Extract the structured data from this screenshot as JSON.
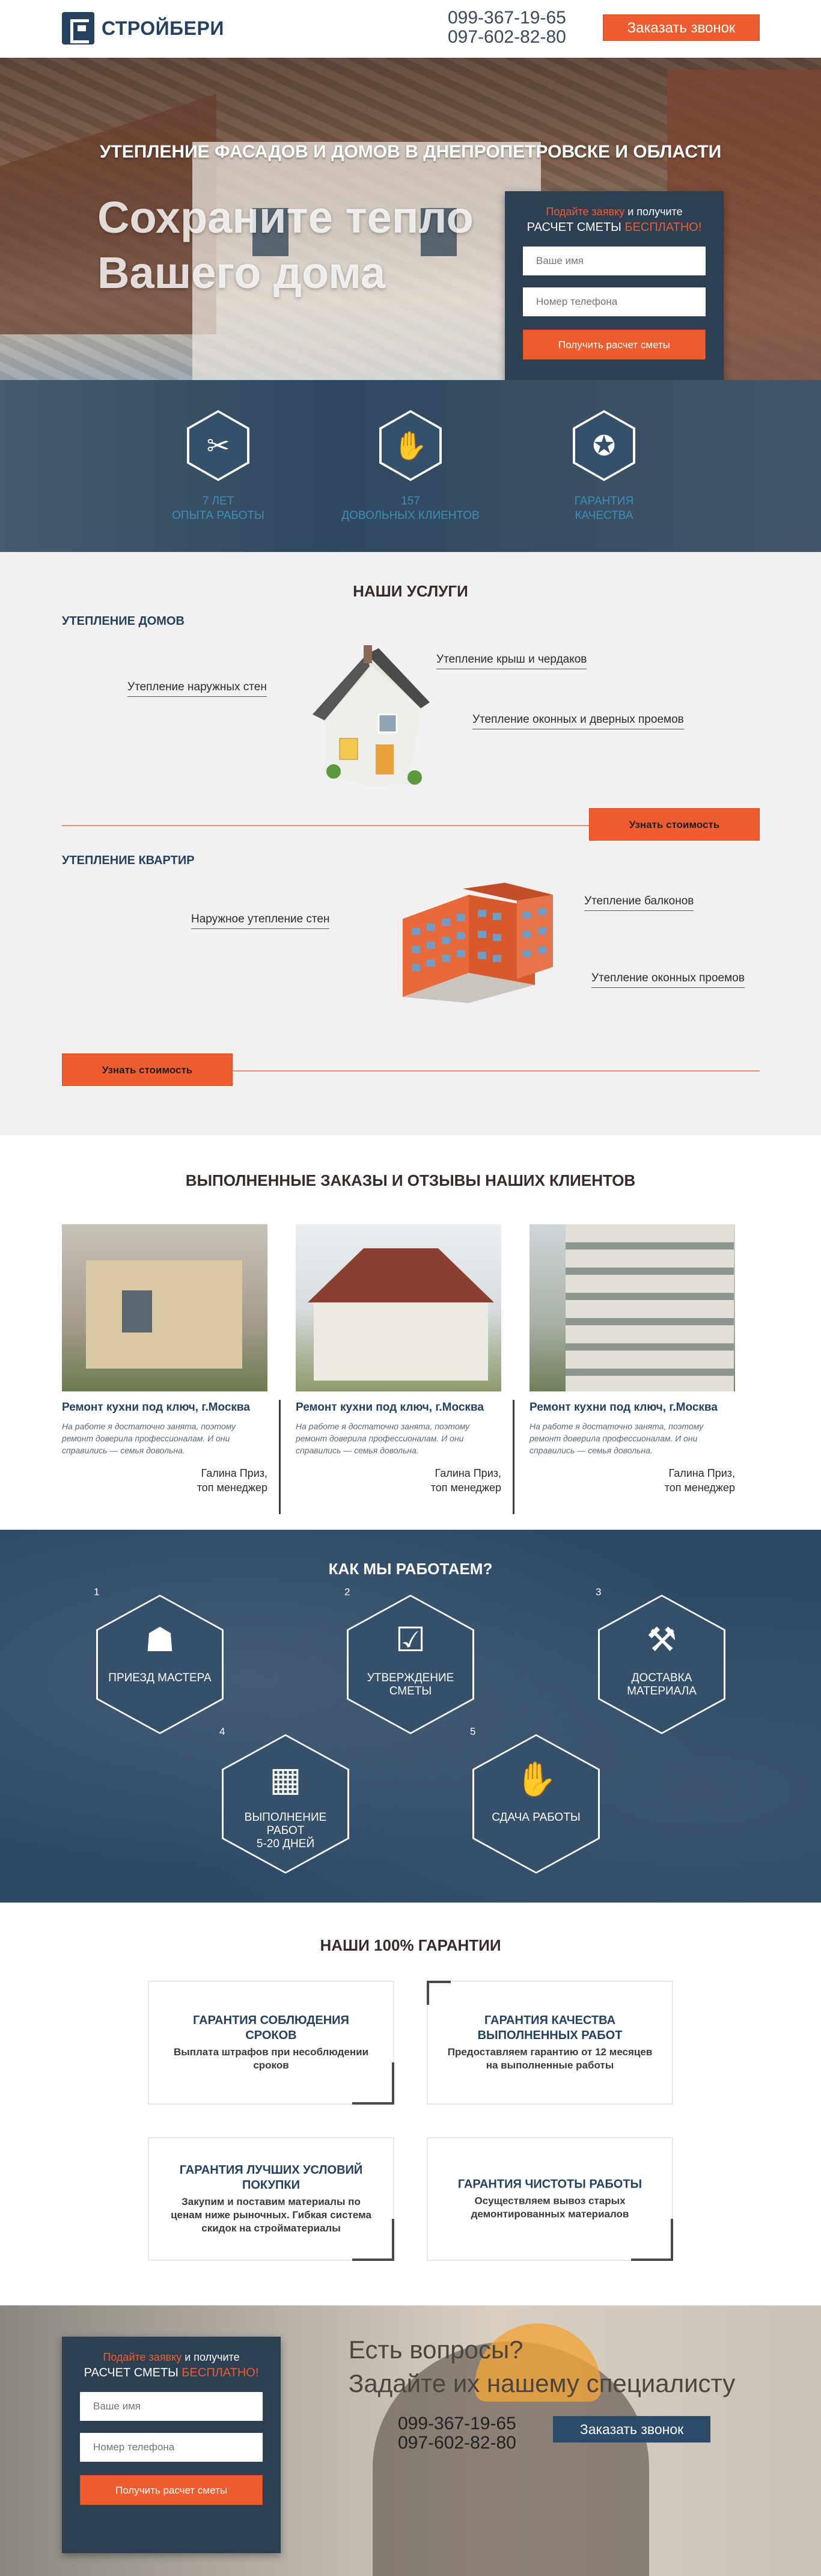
{
  "header": {
    "logo_text": "СТРОЙБЕРИ",
    "phone1": "099-367-19-65",
    "phone2": "097-602-82-80",
    "call_button": "Заказать звонок"
  },
  "hero": {
    "title": "УТЕПЛЕНИЕ ФАСАДОВ И ДОМОВ В ДНЕПРОПЕТРОВСКЕ И ОБЛАСТИ",
    "slogan_line1": "Сохраните тепло",
    "slogan_line2": "Вашего дома",
    "form": {
      "line1_orange": "Подайте заявку",
      "line1_rest": " и получите",
      "line2_white": "РАСЧЕТ СМЕТЫ ",
      "line2_orange": "БЕСПЛАТНО!",
      "name_placeholder": "Ваше имя",
      "phone_placeholder": "Номер телефона",
      "submit": "Получить расчет сметы"
    }
  },
  "stats": [
    {
      "icon": "tools-icon",
      "glyph": "✂",
      "line1": "7 ЛЕТ",
      "line2": "ОПЫТА РАБОТЫ"
    },
    {
      "icon": "handshake-icon",
      "glyph": "✋",
      "line1": "157",
      "line2": "ДОВОЛЬНЫХ КЛИЕНТОВ"
    },
    {
      "icon": "quality-badge-icon",
      "glyph": "✪",
      "line1": "ГАРАНТИЯ",
      "line2": "КАЧЕСТВА"
    }
  ],
  "services": {
    "title": "НАШИ УСЛУГИ",
    "houses": {
      "title": "УТЕПЛЕНИЕ ДОМОВ",
      "callout_left": "Утепление наружных стен",
      "callout_top": "Утепление крыш и чердаков",
      "callout_right": "Утепление оконных и дверных проемов",
      "button": "Узнать стоимость"
    },
    "apartments": {
      "title": "УТЕПЛЕНИЕ КВАРТИР",
      "callout_left": "Наружное утепление стен",
      "callout_top": "Утепление балконов",
      "callout_right": "Утепление оконных проемов",
      "button": "Узнать стоимость"
    }
  },
  "projects": {
    "title": "ВЫПОЛНЕННЫЕ ЗАКАЗЫ И ОТЗЫВЫ НАШИХ КЛИЕНТОВ",
    "cards": [
      {
        "title": "Ремонт кухни под ключ, г.Москва",
        "text": "На работе я достаточно занята, поэтому ремонт доверила профессионалам. И они справились — семья довольна.",
        "name": "Галина Приз,",
        "role": "топ менеджер"
      },
      {
        "title": "Ремонт кухни под ключ, г.Москва",
        "text": "На работе я достаточно занята, поэтому ремонт доверила профессионалам. И они справились — семья довольна.",
        "name": "Галина Приз,",
        "role": "топ менеджер"
      },
      {
        "title": "Ремонт кухни под ключ, г.Москва",
        "text": "На работе я достаточно занята, поэтому ремонт доверила профессионалам. И они справились — семья довольна.",
        "name": "Галина Приз,",
        "role": "топ менеджер"
      }
    ]
  },
  "how": {
    "title": "КАК МЫ РАБОТАЕМ?",
    "steps": [
      {
        "num": "1",
        "icon": "worker-icon",
        "glyph": "☗",
        "line1": "ПРИЕЗД МАСТЕРА",
        "line2": ""
      },
      {
        "num": "2",
        "icon": "checklist-icon",
        "glyph": "☑",
        "line1": "УТВЕРЖДЕНИЕ",
        "line2": "СМЕТЫ"
      },
      {
        "num": "3",
        "icon": "toolbox-icon",
        "glyph": "⚒",
        "line1": "ДОСТАВКА",
        "line2": "МАТЕРИАЛА"
      },
      {
        "num": "4",
        "icon": "paint-roller-icon",
        "glyph": "▦",
        "line1": "ВЫПОЛНЕНИЕ РАБОТ",
        "line2": "5-20 ДНЕЙ"
      },
      {
        "num": "5",
        "icon": "handshake-icon",
        "glyph": "✋",
        "line1": "СДАЧА РАБОТЫ",
        "line2": ""
      }
    ]
  },
  "guarantees": {
    "title": "НАШИ 100% ГАРАНТИИ",
    "items": [
      {
        "title": "ГАРАНТИЯ СОБЛЮДЕНИЯ СРОКОВ",
        "text": "Выплата штрафов при несоблюдении сроков"
      },
      {
        "title": "ГАРАНТИЯ КАЧЕСТВА ВЫПОЛНЕННЫХ РАБОТ",
        "text": "Предоставляем гарантию от 12 месяцев на выполненные работы"
      },
      {
        "title": "ГАРАНТИЯ ЛУЧШИХ УСЛОВИЙ ПОКУПКИ",
        "text": "Закупим и поставим материалы по ценам ниже рыночных. Гибкая система скидок на стройматериалы"
      },
      {
        "title": "ГАРАНТИЯ ЧИСТОТЫ РАБОТЫ",
        "text": "Осуществляем вывоз старых демонтированных материалов"
      }
    ]
  },
  "contact": {
    "form": {
      "line1_orange": "Подайте заявку",
      "line1_rest": " и получите",
      "line2_white": "РАСЧЕТ СМЕТЫ ",
      "line2_orange": "БЕСПЛАТНО!",
      "name_placeholder": "Ваше имя",
      "phone_placeholder": "Номер телефона",
      "submit": "Получить расчет сметы"
    },
    "question1": "Есть вопросы?",
    "question2": "Задайте их нашему специалисту",
    "phone1": "099-367-19-65",
    "phone2": "097-602-82-80",
    "call_button": "Заказать звонок"
  },
  "colors": {
    "accent": "#ef5d2e",
    "primary": "#24425f",
    "dark_panel": "#2c3f53"
  }
}
